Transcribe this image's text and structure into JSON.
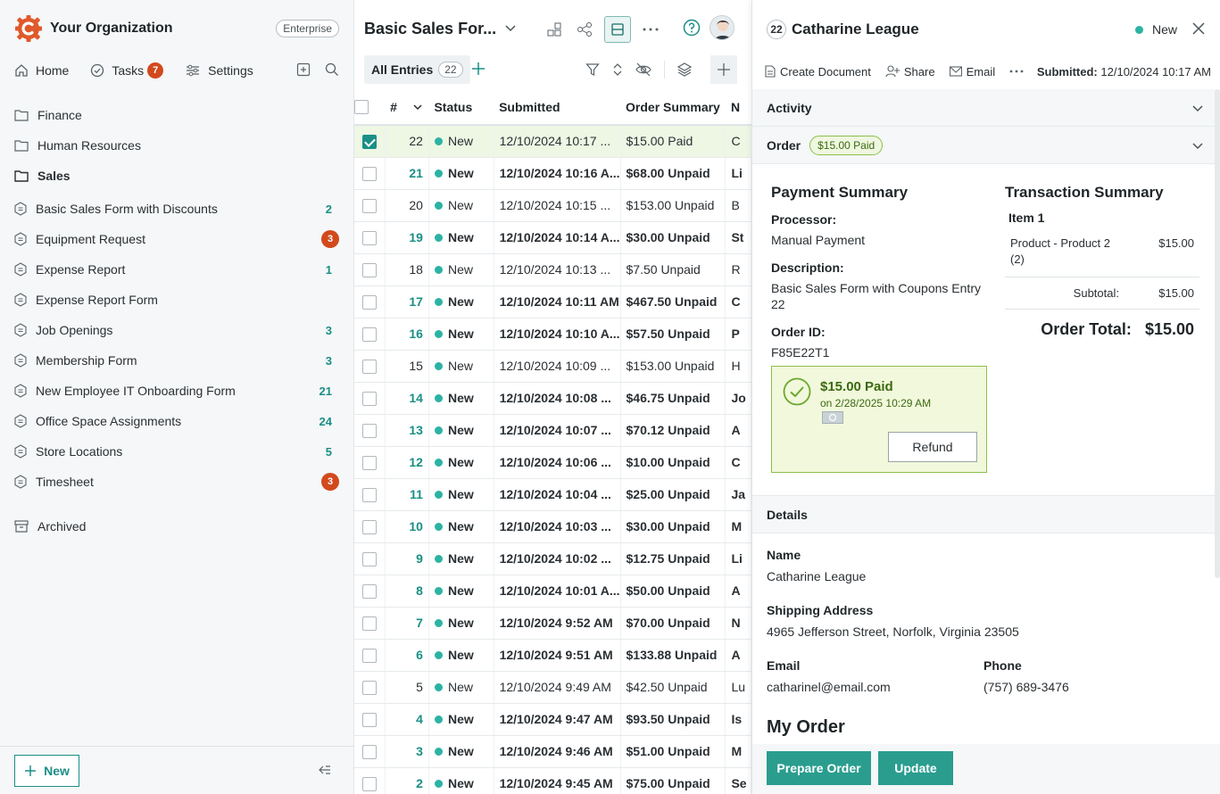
{
  "org": {
    "name": "Your Organization",
    "plan": "Enterprise"
  },
  "nav": {
    "home": "Home",
    "tasks": "Tasks",
    "tasks_count": "7",
    "settings": "Settings"
  },
  "folders": [
    "Finance",
    "Human Resources",
    "Sales"
  ],
  "forms": [
    {
      "name": "Basic Sales Form with Discounts",
      "count": "2",
      "alert": false
    },
    {
      "name": "Equipment Request",
      "count": "3",
      "alert": true
    },
    {
      "name": "Expense Report",
      "count": "1",
      "alert": false
    },
    {
      "name": "Expense Report Form",
      "count": "",
      "alert": false
    },
    {
      "name": "Job Openings",
      "count": "3",
      "alert": false
    },
    {
      "name": "Membership Form",
      "count": "3",
      "alert": false
    },
    {
      "name": "New Employee IT Onboarding Form",
      "count": "21",
      "alert": false
    },
    {
      "name": "Office Space Assignments",
      "count": "24",
      "alert": false
    },
    {
      "name": "Store Locations",
      "count": "5",
      "alert": false
    },
    {
      "name": "Timesheet",
      "count": "3",
      "alert": true
    }
  ],
  "archived": "Archived",
  "new_button": "New",
  "entries_view": {
    "form_title": "Basic Sales For...",
    "view_name": "All Entries",
    "view_count": "22",
    "columns": [
      "#",
      "Status",
      "Submitted",
      "Order Summary",
      "N"
    ],
    "rows": [
      {
        "num": "22",
        "status": "New",
        "submitted": "12/10/2024 10:17 ...",
        "order": "$15.00 Paid",
        "n": "C",
        "unread": false,
        "selected": true
      },
      {
        "num": "21",
        "status": "New",
        "submitted": "12/10/2024 10:16 A...",
        "order": "$68.00 Unpaid",
        "n": "Li",
        "unread": true,
        "selected": false
      },
      {
        "num": "20",
        "status": "New",
        "submitted": "12/10/2024 10:15 ...",
        "order": "$153.00 Unpaid",
        "n": "B",
        "unread": false,
        "selected": false
      },
      {
        "num": "19",
        "status": "New",
        "submitted": "12/10/2024 10:14 A...",
        "order": "$30.00 Unpaid",
        "n": "St",
        "unread": true,
        "selected": false
      },
      {
        "num": "18",
        "status": "New",
        "submitted": "12/10/2024 10:13 ...",
        "order": "$7.50 Unpaid",
        "n": "R",
        "unread": false,
        "selected": false
      },
      {
        "num": "17",
        "status": "New",
        "submitted": "12/10/2024 10:11 AM",
        "order": "$467.50 Unpaid",
        "n": "C",
        "unread": true,
        "selected": false
      },
      {
        "num": "16",
        "status": "New",
        "submitted": "12/10/2024 10:10 A...",
        "order": "$57.50 Unpaid",
        "n": "P",
        "unread": true,
        "selected": false
      },
      {
        "num": "15",
        "status": "New",
        "submitted": "12/10/2024 10:09 ...",
        "order": "$153.00 Unpaid",
        "n": "H",
        "unread": false,
        "selected": false
      },
      {
        "num": "14",
        "status": "New",
        "submitted": "12/10/2024 10:08 ...",
        "order": "$46.75 Unpaid",
        "n": "Jo",
        "unread": true,
        "selected": false
      },
      {
        "num": "13",
        "status": "New",
        "submitted": "12/10/2024 10:07 ...",
        "order": "$70.12 Unpaid",
        "n": "A",
        "unread": true,
        "selected": false
      },
      {
        "num": "12",
        "status": "New",
        "submitted": "12/10/2024 10:06 ...",
        "order": "$10.00 Unpaid",
        "n": "C",
        "unread": true,
        "selected": false
      },
      {
        "num": "11",
        "status": "New",
        "submitted": "12/10/2024 10:04 ...",
        "order": "$25.00 Unpaid",
        "n": "Ja",
        "unread": true,
        "selected": false
      },
      {
        "num": "10",
        "status": "New",
        "submitted": "12/10/2024 10:03 ...",
        "order": "$30.00 Unpaid",
        "n": "M",
        "unread": true,
        "selected": false
      },
      {
        "num": "9",
        "status": "New",
        "submitted": "12/10/2024 10:02 ...",
        "order": "$12.75 Unpaid",
        "n": "Li",
        "unread": true,
        "selected": false
      },
      {
        "num": "8",
        "status": "New",
        "submitted": "12/10/2024 10:01 A...",
        "order": "$50.00 Unpaid",
        "n": "A",
        "unread": true,
        "selected": false
      },
      {
        "num": "7",
        "status": "New",
        "submitted": "12/10/2024 9:52 AM",
        "order": "$70.00 Unpaid",
        "n": "N",
        "unread": true,
        "selected": false
      },
      {
        "num": "6",
        "status": "New",
        "submitted": "12/10/2024 9:51 AM",
        "order": "$133.88 Unpaid",
        "n": "A",
        "unread": true,
        "selected": false
      },
      {
        "num": "5",
        "status": "New",
        "submitted": "12/10/2024 9:49 AM",
        "order": "$42.50 Unpaid",
        "n": "Lu",
        "unread": false,
        "selected": false
      },
      {
        "num": "4",
        "status": "New",
        "submitted": "12/10/2024 9:47 AM",
        "order": "$93.50 Unpaid",
        "n": "Is",
        "unread": true,
        "selected": false
      },
      {
        "num": "3",
        "status": "New",
        "submitted": "12/10/2024 9:46 AM",
        "order": "$51.00 Unpaid",
        "n": "M",
        "unread": true,
        "selected": false
      },
      {
        "num": "2",
        "status": "New",
        "submitted": "12/10/2024 9:45 AM",
        "order": "$75.00 Unpaid",
        "n": "Se",
        "unread": true,
        "selected": false
      }
    ]
  },
  "detail": {
    "entry_number": "22",
    "name": "Catharine League",
    "status": "New",
    "actions": {
      "create_document": "Create Document",
      "share": "Share",
      "email": "Email"
    },
    "submitted_label": "Submitted:",
    "submitted_value": "12/10/2024 10:17 AM",
    "activity_label": "Activity",
    "order_label": "Order",
    "order_pill": "$15.00 Paid",
    "payment": {
      "title": "Payment Summary",
      "processor_label": "Processor:",
      "processor": "Manual Payment",
      "description_label": "Description:",
      "description": "Basic Sales Form with Coupons Entry 22",
      "order_id_label": "Order ID:",
      "order_id": "F85E22T1",
      "paid_amount": "$15.00 Paid",
      "paid_date": "on 2/28/2025 10:29 AM",
      "refund": "Refund"
    },
    "transaction": {
      "title": "Transaction Summary",
      "item_label": "Item 1",
      "product": "Product - Product 2 (2)",
      "product_price": "$15.00",
      "subtotal_label": "Subtotal:",
      "subtotal": "$15.00",
      "total_label": "Order Total:",
      "total": "$15.00"
    },
    "details_label": "Details",
    "fields": {
      "name_label": "Name",
      "name": "Catharine League",
      "address_label": "Shipping Address",
      "address": "4965 Jefferson Street, Norfolk, Virginia 23505",
      "email_label": "Email",
      "email": "catharinel@email.com",
      "phone_label": "Phone",
      "phone": "(757) 689-3476"
    },
    "my_order": "My Order",
    "prepare_order": "Prepare Order",
    "update": "Update"
  },
  "colors": {
    "accent": "#1a8f86",
    "alert": "#d2491d",
    "paid_green": "#8cc04b",
    "primary_button": "#2a9d8f"
  }
}
